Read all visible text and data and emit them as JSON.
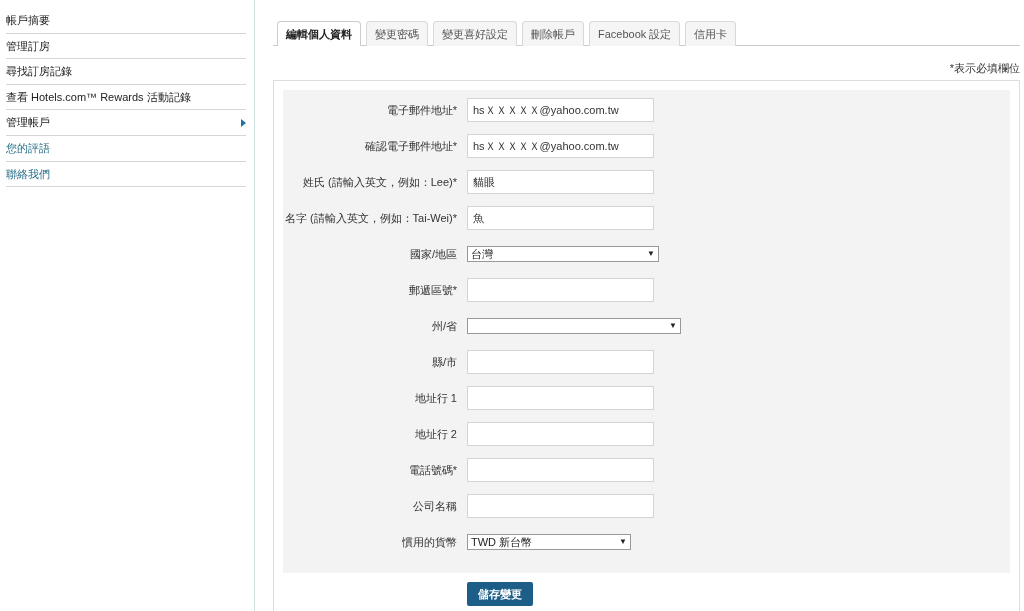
{
  "sidebar": {
    "items": [
      {
        "label": "帳戶摘要",
        "kind": "plain",
        "selected": false
      },
      {
        "label": "管理訂房",
        "kind": "plain",
        "selected": false
      },
      {
        "label": "尋找訂房記錄",
        "kind": "plain",
        "selected": false
      },
      {
        "label": "查看 Hotels.com™ Rewards 活動記錄",
        "kind": "plain",
        "selected": false
      },
      {
        "label": "管理帳戶",
        "kind": "plain",
        "selected": true
      },
      {
        "label": "您的評語",
        "kind": "link",
        "selected": false
      },
      {
        "label": "聯絡我們",
        "kind": "link",
        "selected": false
      }
    ]
  },
  "tabs": [
    {
      "label": "編輯個人資料",
      "selected": true
    },
    {
      "label": "變更密碼",
      "selected": false
    },
    {
      "label": "變更喜好設定",
      "selected": false
    },
    {
      "label": "刪除帳戶",
      "selected": false
    },
    {
      "label": "Facebook 設定",
      "selected": false
    },
    {
      "label": "信用卡",
      "selected": false
    }
  ],
  "required_note": "*表示必填欄位",
  "form": {
    "fields": [
      {
        "label": "電子郵件地址*",
        "kind": "text",
        "value": "hsＸＸＸＸＸ@yahoo.com.tw"
      },
      {
        "label": "確認電子郵件地址*",
        "kind": "text",
        "value": "hsＸＸＸＸＸ@yahoo.com.tw"
      },
      {
        "label": "姓氏 (請輸入英文，例如：Lee)*",
        "kind": "text",
        "value": "貓眼"
      },
      {
        "label": "名字 (請輸入英文，例如：Tai-Wei)*",
        "kind": "text",
        "value": "魚"
      },
      {
        "label": "國家/地區",
        "kind": "select",
        "value": "台灣",
        "arrow": "▼"
      },
      {
        "label": "郵遞區號*",
        "kind": "text"
      },
      {
        "label": "州/省",
        "kind": "select",
        "arrow": "▼"
      },
      {
        "label": "縣/市",
        "kind": "text"
      },
      {
        "label": "地址行 1",
        "kind": "text"
      },
      {
        "label": "地址行 2",
        "kind": "text"
      },
      {
        "label": "電話號碼*",
        "kind": "text"
      },
      {
        "label": "公司名稱",
        "kind": "text"
      },
      {
        "label": "慣用的貨幣",
        "kind": "select",
        "value": "TWD 新台幣",
        "arrow": "▼"
      }
    ],
    "save_button": "儲存變更"
  }
}
